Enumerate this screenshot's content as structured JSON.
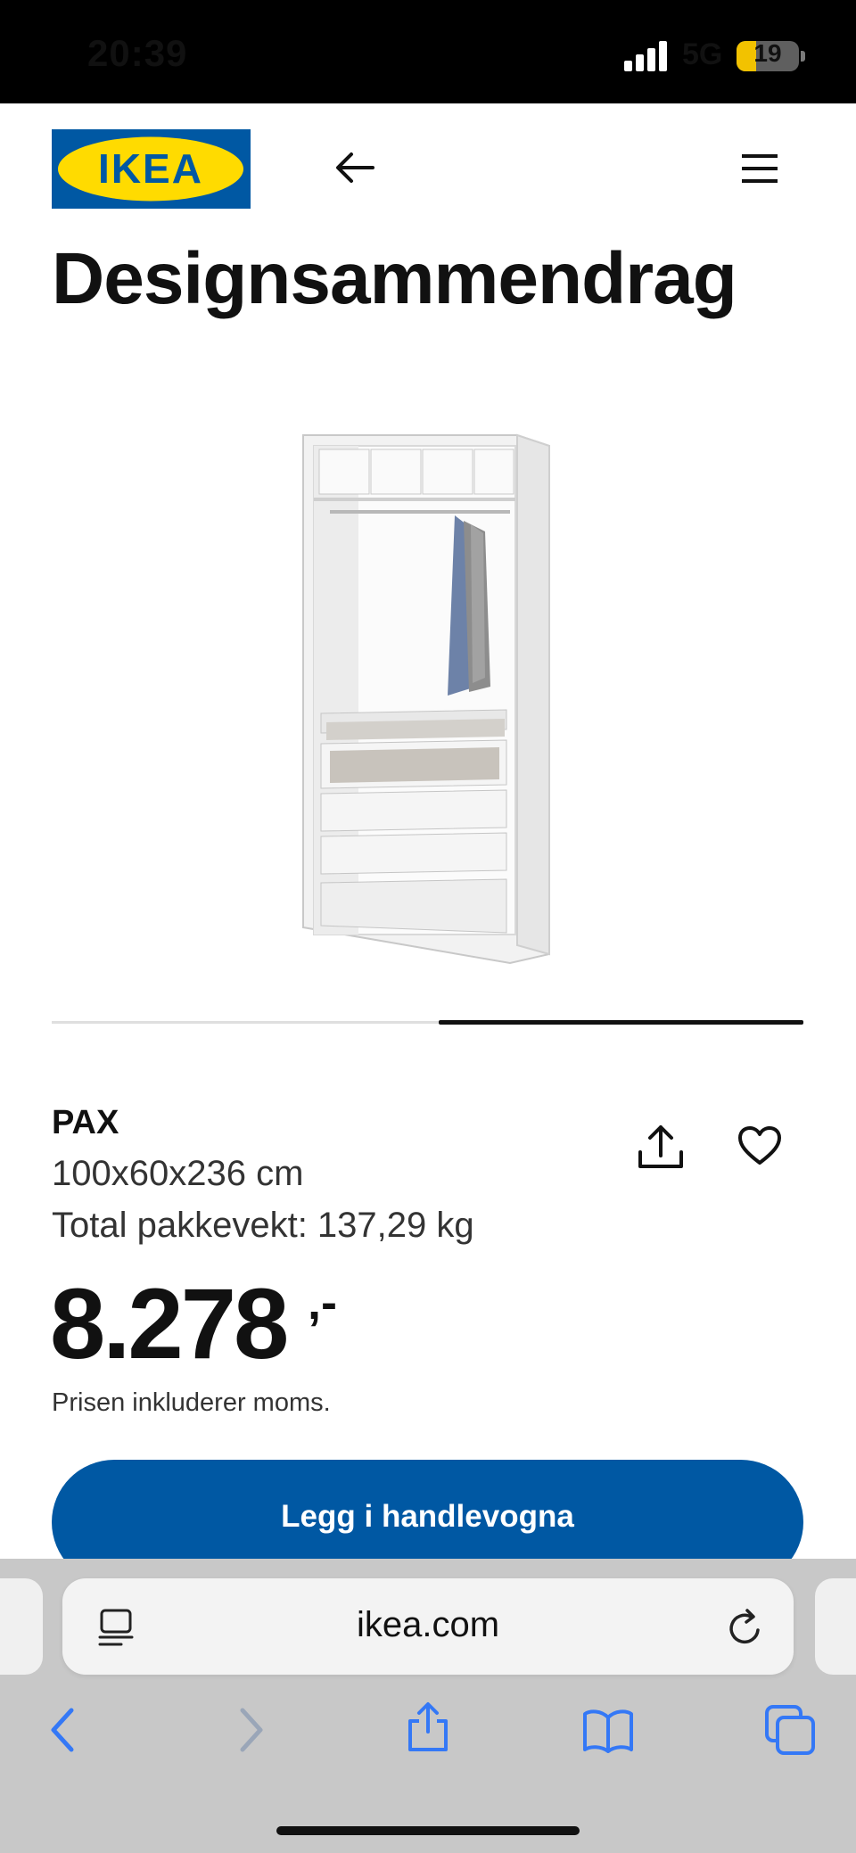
{
  "status_bar": {
    "time": "20:39",
    "network": "5G",
    "battery": "19"
  },
  "header": {
    "logo_text": "IKEA",
    "back_icon": "arrow-left-icon",
    "menu_icon": "hamburger-menu-icon"
  },
  "page": {
    "title": "Designsammendrag"
  },
  "product": {
    "name": "PAX",
    "dimensions": "100x60x236 cm",
    "weight": "Total pakkevekt: 137,29 kg",
    "price": "8.278",
    "price_suffix": ",-",
    "vat_note": "Prisen inkluderer moms.",
    "add_to_cart_label": "Legg i handlevogna",
    "image_icon": "wardrobe-image",
    "gallery_progress": 0.5
  },
  "browser": {
    "url": "ikea.com",
    "icons": [
      "reader-icon",
      "reload-icon",
      "back-icon",
      "forward-icon",
      "share-icon",
      "bookmarks-icon",
      "tabs-icon"
    ]
  },
  "colors": {
    "brand_blue": "#0058a3",
    "brand_yellow": "#ffdb00",
    "ios_blue": "#3478f6"
  }
}
